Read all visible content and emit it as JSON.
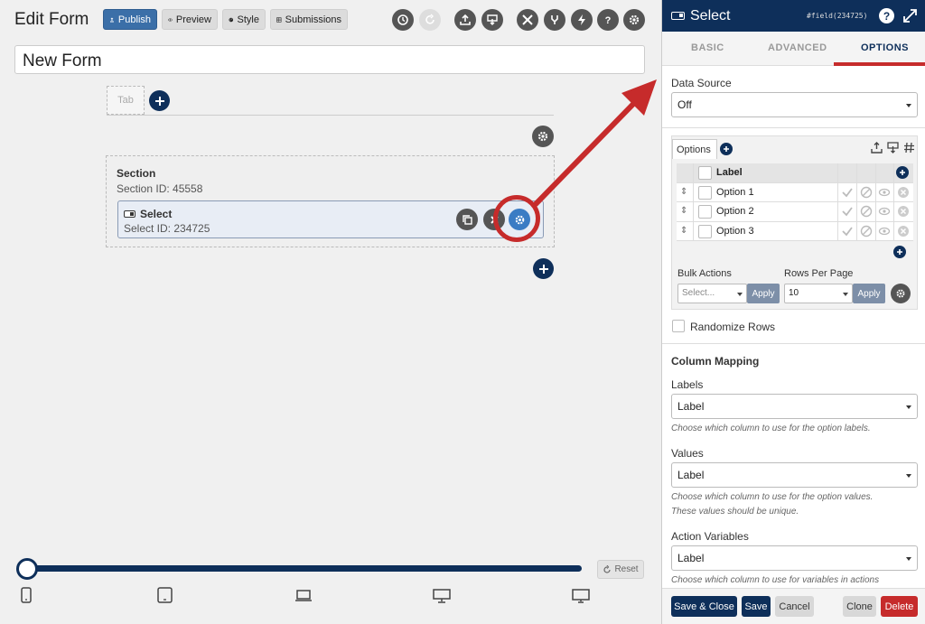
{
  "toolbar": {
    "title": "Edit Form",
    "publish_label": "Publish",
    "preview_label": "Preview",
    "style_label": "Style",
    "submissions_label": "Submissions",
    "icons": [
      "history-icon",
      "redo-icon",
      "export-icon",
      "import-icon",
      "tools-icon",
      "branch-icon",
      "bolt-icon",
      "help-icon",
      "gear-icon"
    ]
  },
  "form": {
    "title_value": "New Form"
  },
  "canvas": {
    "tab_label": "Tab",
    "section_title": "Section",
    "section_id": "Section  ID: 45558",
    "field_title": "Select",
    "field_id": "Select  ID: 234725",
    "reset_label": "Reset",
    "devices": [
      "phone-icon",
      "tablet-icon",
      "laptop-icon",
      "desktop-icon",
      "monitor-icon"
    ]
  },
  "panel": {
    "title": "Select",
    "field_ref": "#field(234725)",
    "tabs": {
      "basic": "BASIC",
      "advanced": "ADVANCED",
      "options": "OPTIONS"
    },
    "active_tab": "options",
    "data_source_label": "Data Source",
    "data_source_value": "Off",
    "options_tab_label": "Options",
    "grid_header_label": "Label",
    "options": [
      "Option 1",
      "Option 2",
      "Option 3"
    ],
    "bulk_actions_label": "Bulk Actions",
    "bulk_select_placeholder": "Select...",
    "apply_label": "Apply",
    "rows_per_page_label": "Rows Per Page",
    "rows_per_page_value": "10",
    "randomize_label": "Randomize Rows",
    "column_mapping_heading": "Column Mapping",
    "labels_label": "Labels",
    "labels_value": "Label",
    "labels_hint": "Choose which column to use for the option labels.",
    "values_label": "Values",
    "values_value": "Label",
    "values_hint_1": "Choose which column to use for the option values.",
    "values_hint_2": "These values should be unique.",
    "action_vars_label": "Action Variables",
    "action_vars_value": "Label",
    "action_vars_hint": "Choose which column to use for variables in actions"
  },
  "footer": {
    "save_close": "Save & Close",
    "save": "Save",
    "cancel": "Cancel",
    "clone": "Clone",
    "delete": "Delete"
  },
  "colors": {
    "navy": "#0e2f5a",
    "accent_red": "#c62b2b",
    "publish_blue": "#3b6fa8",
    "selected_gear": "#3a7cc4"
  }
}
